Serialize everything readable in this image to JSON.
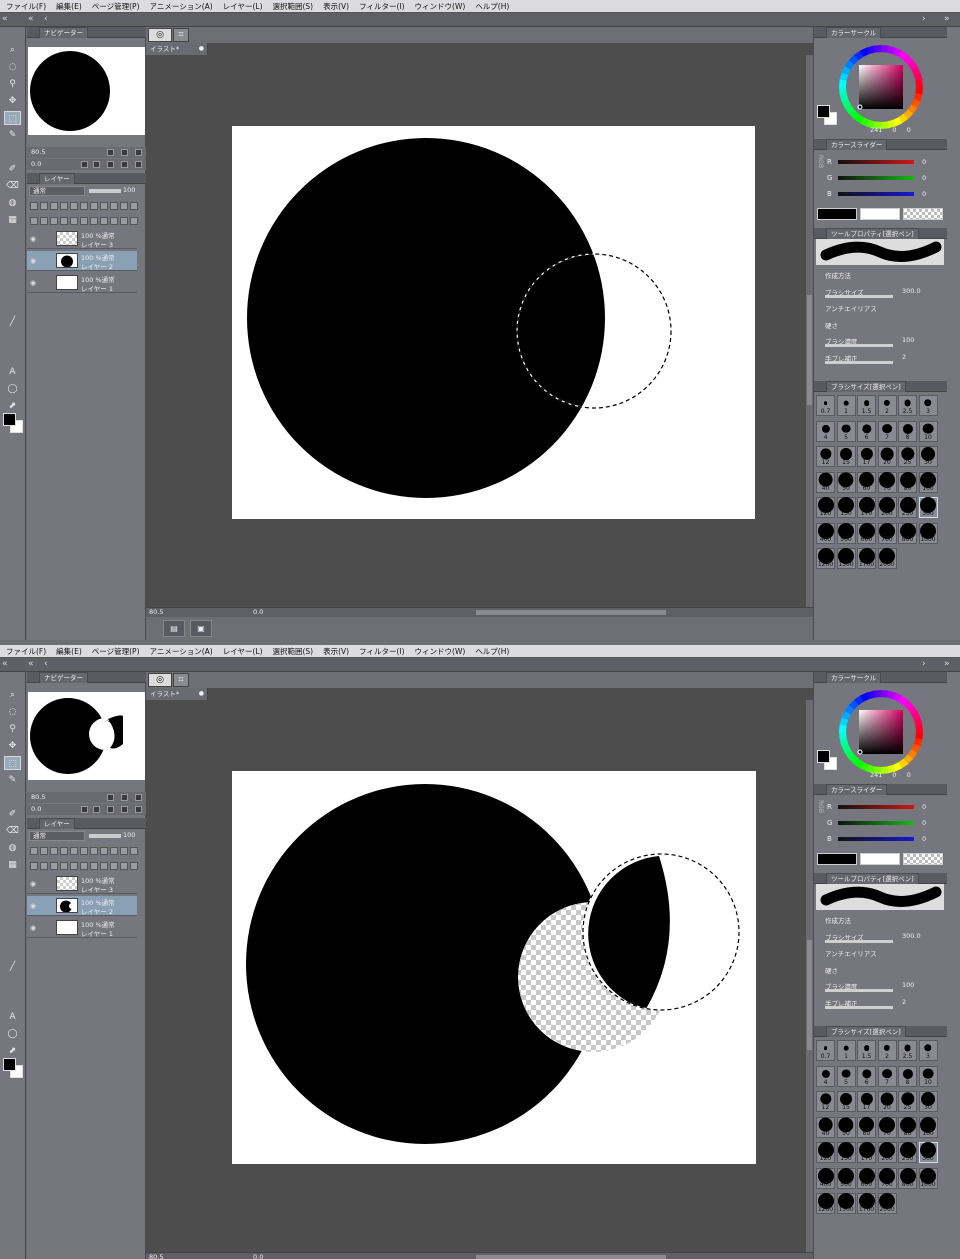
{
  "menu": [
    "ファイル(F)",
    "編集(E)",
    "ページ管理(P)",
    "アニメーション(A)",
    "レイヤー(L)",
    "選択範囲(S)",
    "表示(V)",
    "フィルター(I)",
    "ウィンドウ(W)",
    "ヘルプ(H)"
  ],
  "navigator": {
    "title": "ナビゲーター",
    "zoom": "80.5",
    "angle": "0.0"
  },
  "layer_panel": {
    "title": "レイヤー",
    "blend_mode": "通常",
    "opacity": "100",
    "layers": [
      {
        "line1": "100 %通常",
        "line2": "レイヤー 3"
      },
      {
        "line1": "100 %通常",
        "line2": "レイヤー 2"
      },
      {
        "line1": "100 %通常",
        "line2": "レイヤー 1"
      }
    ]
  },
  "document": {
    "tab": "イラスト*",
    "zoom": "80.5",
    "angle": "0.0"
  },
  "color_wheel": {
    "title": "カラーサークル",
    "h": "241",
    "s": "0",
    "v": "0"
  },
  "color_slider": {
    "title": "カラースライダー",
    "r_label": "R",
    "g_label": "G",
    "b_label": "B",
    "r": "0",
    "g": "0",
    "b": "0",
    "mode": "RGB"
  },
  "colors": {
    "bar_r": "#d01818",
    "bar_g": "#18b818",
    "bar_b": "#1818d0",
    "canvas_bg": "#4d4d4d"
  },
  "tool_property": {
    "title": "ツールプロパティ[選択ペン]",
    "tool": "選択ペン",
    "rows": [
      {
        "label": "作成方法",
        "value": ""
      },
      {
        "label": "ブラシサイズ",
        "value": "300.0"
      },
      {
        "label": "アンチエイリアス",
        "value": ""
      },
      {
        "label": "硬さ",
        "value": ""
      },
      {
        "label": "ブラシ濃度",
        "value": "100"
      },
      {
        "label": "手ブレ補正",
        "value": "2"
      }
    ]
  },
  "brush_size": {
    "title": "ブラシサイズ[選択ペン]",
    "sizes": [
      "0.7",
      "1",
      "1.5",
      "2",
      "2.5",
      "3",
      "4",
      "5",
      "6",
      "7",
      "8",
      "10",
      "12",
      "15",
      "17",
      "20",
      "25",
      "30",
      "40",
      "50",
      "60",
      "70",
      "80",
      "100",
      "120",
      "150",
      "170",
      "200",
      "250",
      "300",
      "400",
      "500",
      "600",
      "700",
      "800",
      "1000",
      "1200",
      "1500",
      "1700",
      "2000"
    ],
    "selected": "300"
  },
  "icons": [
    "magnifier-icon",
    "lasso-icon",
    "eyedropper-icon",
    "move-icon",
    "selection-icon",
    "pen-icon",
    "brush-icon",
    "eraser-icon",
    "fill-icon",
    "gradient-icon",
    "line-icon",
    "text-icon",
    "balloon-icon",
    "object-icon"
  ]
}
